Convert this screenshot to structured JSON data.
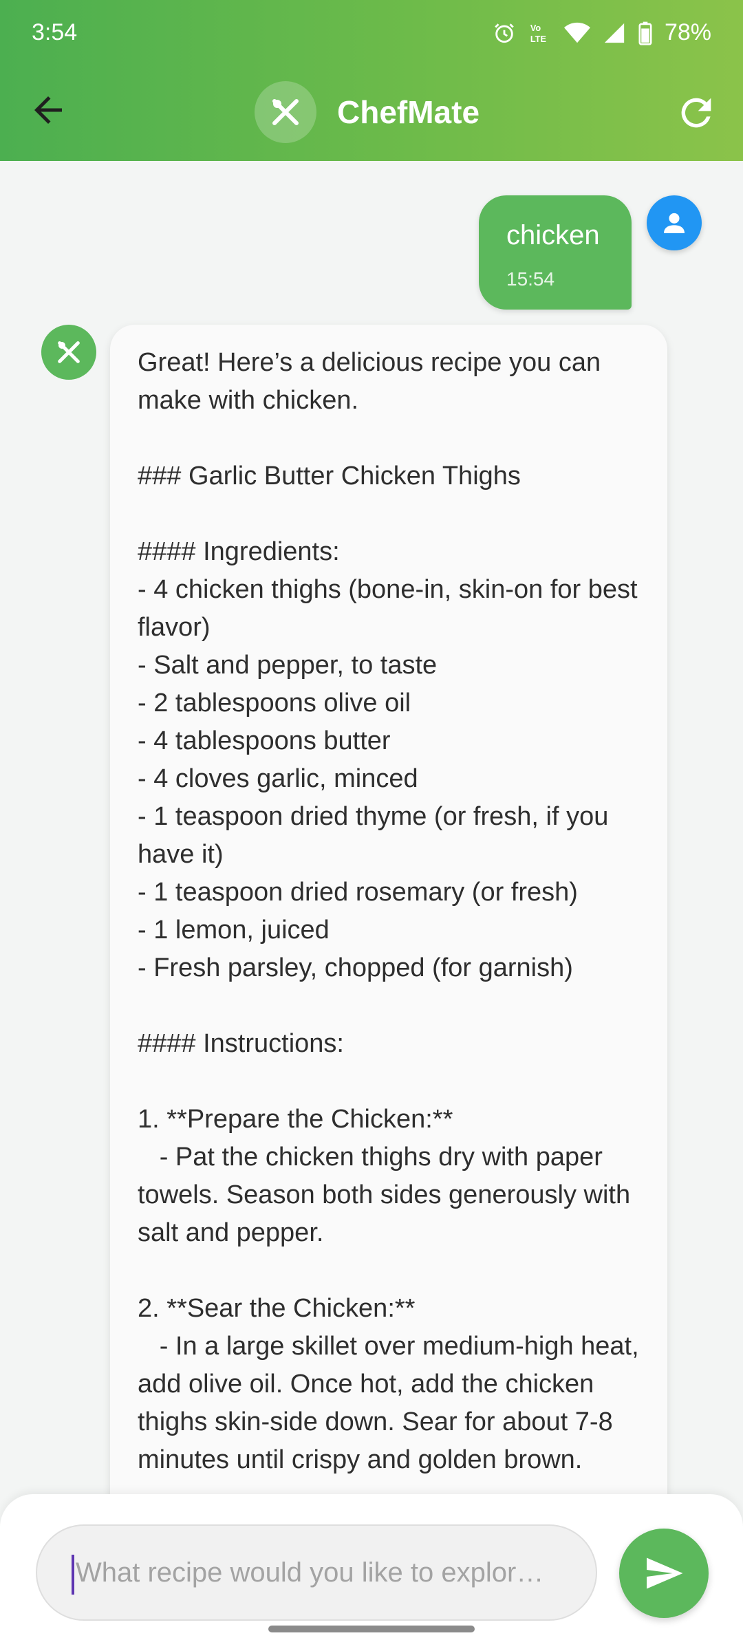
{
  "status_bar": {
    "time": "3:54",
    "battery": "78%",
    "icons": [
      "alarm-icon",
      "volte-icon",
      "wifi-icon",
      "signal-icon",
      "battery-icon"
    ]
  },
  "header": {
    "title": "ChefMate",
    "logo_icon": "utensils-icon",
    "back_icon": "arrow-left-icon",
    "refresh_icon": "refresh-icon",
    "gradient_colors": [
      "#4caf50",
      "#8bc34a"
    ]
  },
  "messages": [
    {
      "sender": "user",
      "text": "chicken",
      "time": "15:54",
      "avatar_icon": "person-icon",
      "bubble_color": "#5cb85c",
      "avatar_color": "#2196f3"
    },
    {
      "sender": "bot",
      "avatar_icon": "utensils-icon",
      "text": "Great! Here’s a delicious recipe you can make with chicken.\n\n### Garlic Butter Chicken Thighs\n\n#### Ingredients:\n- 4 chicken thighs (bone-in, skin-on for best flavor)\n- Salt and pepper, to taste\n- 2 tablespoons olive oil\n- 4 tablespoons butter\n- 4 cloves garlic, minced\n- 1 teaspoon dried thyme (or fresh, if you have it)\n- 1 teaspoon dried rosemary (or fresh)\n- 1 lemon, juiced\n- Fresh parsley, chopped (for garnish)\n\n#### Instructions:\n\n1. **Prepare the Chicken:**\n   - Pat the chicken thighs dry with paper towels. Season both sides generously with salt and pepper.\n\n2. **Sear the Chicken:**\n   - In a large skillet over medium-high heat, add olive oil. Once hot, add the chicken thighs skin-side down. Sear for about 7-8 minutes until crispy and golden brown."
    }
  ],
  "input": {
    "placeholder": "What recipe would you like to explor…",
    "value": ""
  },
  "send_icon": "send-icon",
  "accent_color": "#5cb85c"
}
